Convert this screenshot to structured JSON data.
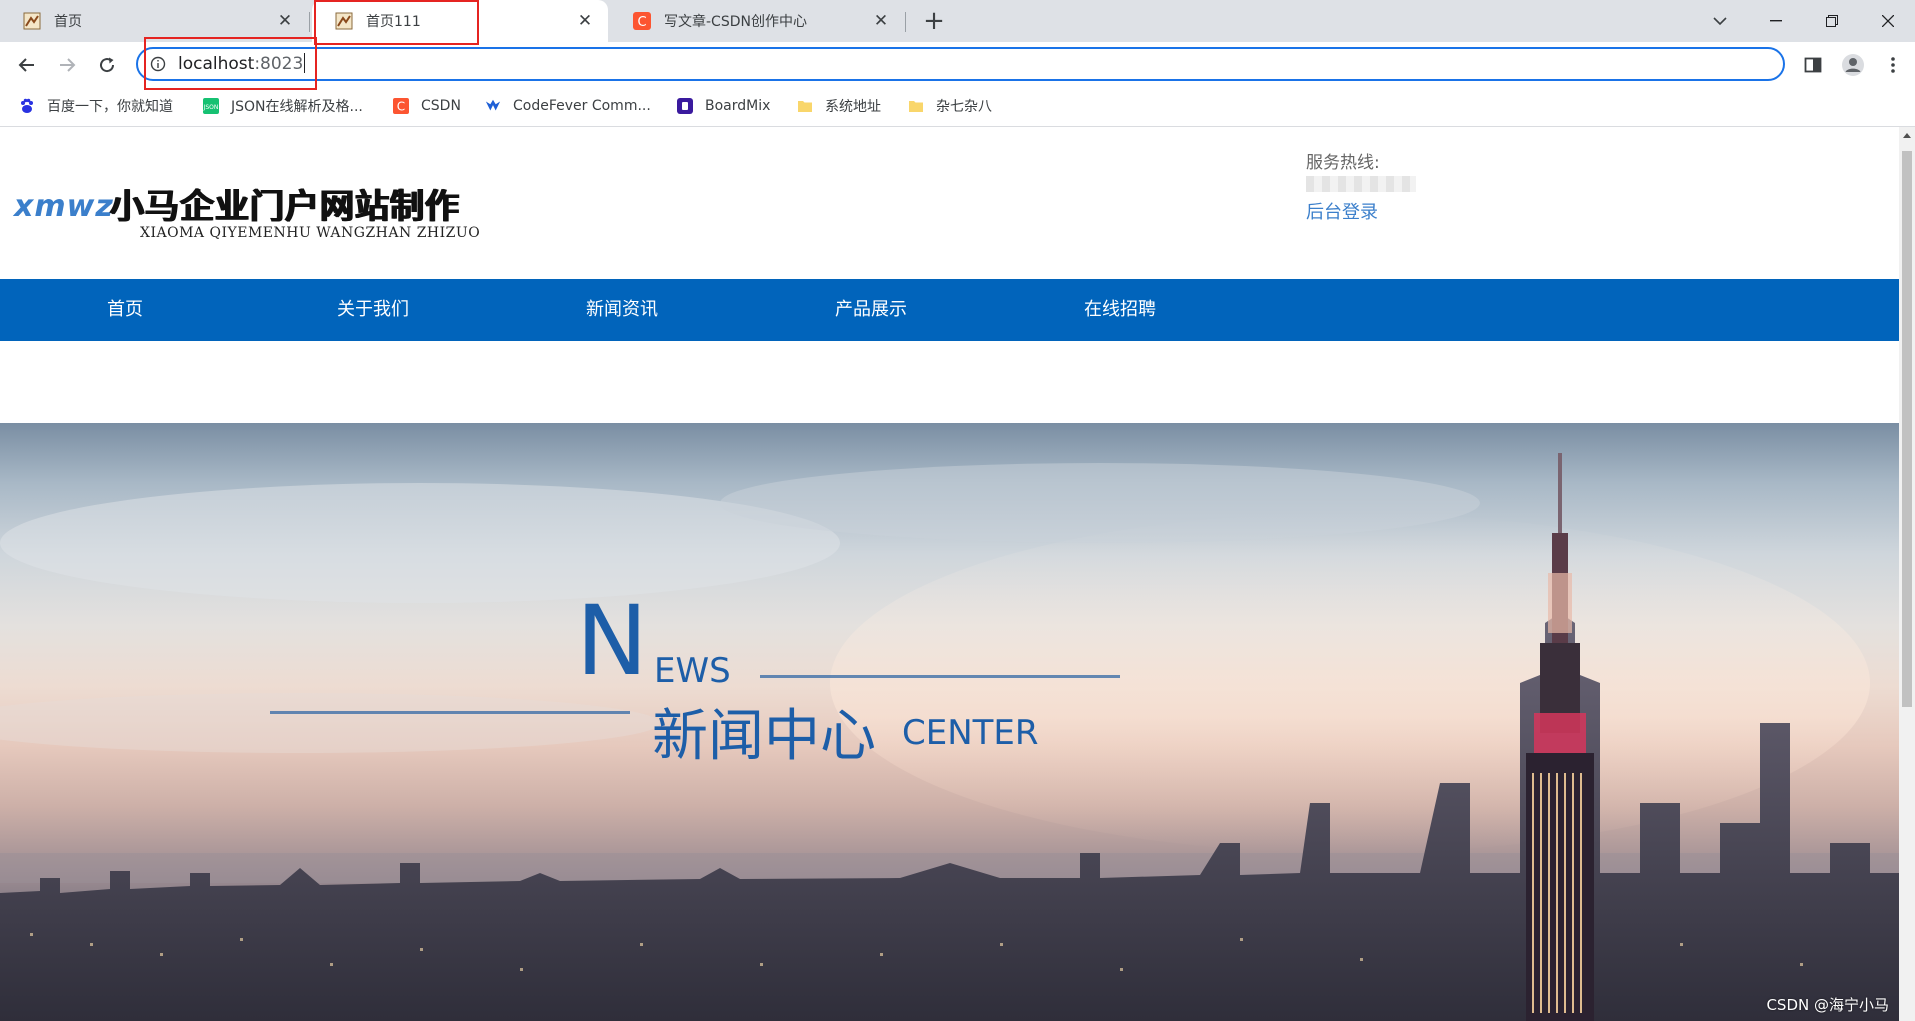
{
  "browser": {
    "tabs": [
      {
        "title": "首页",
        "active": false
      },
      {
        "title": "首页111",
        "active": true
      },
      {
        "title": "写文章-CSDN创作中心",
        "active": false
      }
    ],
    "url_host": "localhost",
    "url_port": ":8023",
    "bookmarks": [
      {
        "label": "百度一下，你就知道",
        "icon": "baidu-icon"
      },
      {
        "label": "JSON在线解析及格...",
        "icon": "json-icon"
      },
      {
        "label": "CSDN",
        "icon": "csdn-icon"
      },
      {
        "label": "CodeFever Comm...",
        "icon": "codefever-icon"
      },
      {
        "label": "BoardMix",
        "icon": "boardmix-icon"
      },
      {
        "label": "系统地址",
        "icon": "folder-icon"
      },
      {
        "label": "杂七杂八",
        "icon": "folder-icon"
      }
    ],
    "accent": "#1a73e8",
    "highlight_color": "#e52421"
  },
  "site": {
    "logo_en": "xmwz",
    "logo_cn": "小马企业门户网站制作",
    "logo_pinyin": "XIAOMA QIYEMENHU WANGZHAN ZHIZUO",
    "hotline_label": "服务热线:",
    "admin_link": "后台登录",
    "nav": [
      {
        "label": "首页"
      },
      {
        "label": "关于我们"
      },
      {
        "label": "新闻资讯"
      },
      {
        "label": "产品展示"
      },
      {
        "label": "在线招聘"
      }
    ],
    "nav_color": "#0164bb",
    "banner": {
      "big_letter": "N",
      "rest_letters": "EWS",
      "title_cn": "新闻中心",
      "title_en": "CENTER"
    },
    "watermark": "CSDN @海宁小马"
  }
}
